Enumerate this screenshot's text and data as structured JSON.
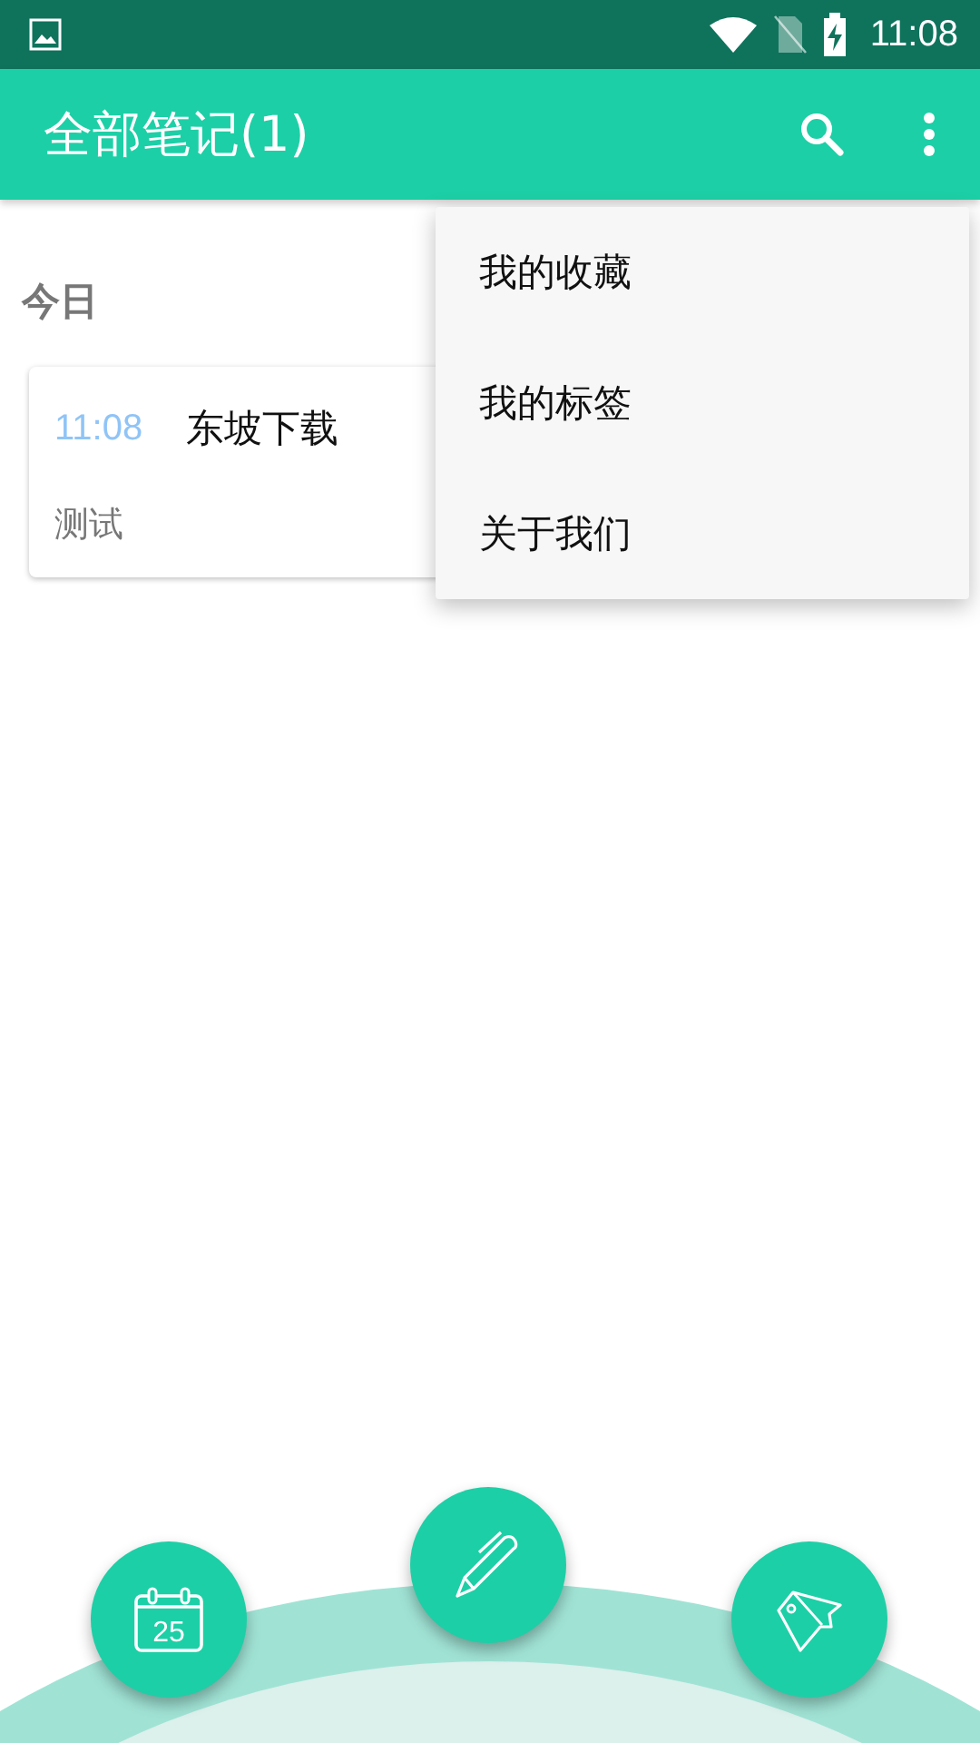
{
  "status_bar": {
    "time": "11:08"
  },
  "app_bar": {
    "title": "全部笔记(1)"
  },
  "sections": [
    {
      "heading": "今日",
      "notes": [
        {
          "time": "11:08",
          "title": "东坡下载",
          "body": "测试"
        }
      ]
    }
  ],
  "menu": {
    "items": [
      "我的收藏",
      "我的标签",
      "关于我们"
    ]
  },
  "fabs": {
    "calendar_day": "25"
  }
}
